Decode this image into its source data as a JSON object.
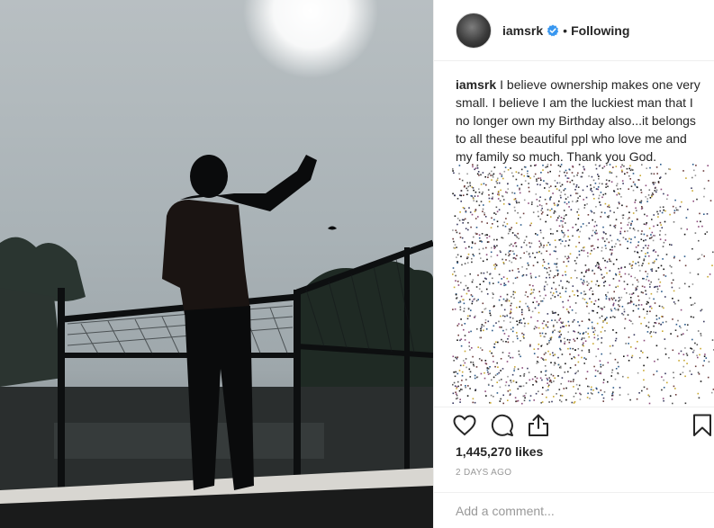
{
  "post": {
    "username": "iamsrk",
    "verified": true,
    "separator": "•",
    "follow_status": "Following",
    "caption_user": "iamsrk",
    "caption_text": "I believe ownership makes one very small. I believe I am the luckiest man that I no longer own my Birthday also...it belongs to all these beautiful ppl who love me and my family so much. Thank you God.",
    "likes": "1,445,270 likes",
    "time_ago": "2 DAYS AGO",
    "comment_placeholder": "Add a comment..."
  },
  "icons": {
    "like": "heart-icon",
    "comment": "speech-bubble-icon",
    "share": "share-icon",
    "save": "bookmark-icon",
    "verified": "verified-badge-icon"
  },
  "colors": {
    "text": "#262626",
    "muted": "#999999",
    "verified": "#3897f0",
    "border": "#efefef"
  }
}
